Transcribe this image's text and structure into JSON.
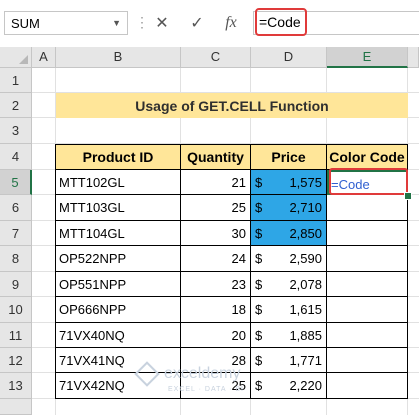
{
  "formula_bar": {
    "name_box": "SUM",
    "cancel_icon": "✕",
    "enter_icon": "✓",
    "fx_label": "fx",
    "formula": "=Code"
  },
  "columns": [
    "A",
    "B",
    "C",
    "D",
    "E"
  ],
  "rows": [
    "1",
    "2",
    "3",
    "4",
    "5",
    "6",
    "7",
    "8",
    "9",
    "10",
    "11",
    "12",
    "13"
  ],
  "title": "Usage of GET.CELL Function",
  "table": {
    "headers": [
      "Product ID",
      "Quantity",
      "Price",
      "Color Code"
    ],
    "rows": [
      {
        "id": "MTT102GL",
        "qty": "21",
        "cur": "$",
        "price": "1,575",
        "code": "=Code"
      },
      {
        "id": "MTT103GL",
        "qty": "25",
        "cur": "$",
        "price": "2,710",
        "code": ""
      },
      {
        "id": "MTT104GL",
        "qty": "30",
        "cur": "$",
        "price": "2,850",
        "code": ""
      },
      {
        "id": "OP522NPP",
        "qty": "24",
        "cur": "$",
        "price": "2,590",
        "code": ""
      },
      {
        "id": "OP551NPP",
        "qty": "23",
        "cur": "$",
        "price": "2,078",
        "code": ""
      },
      {
        "id": "OP666NPP",
        "qty": "18",
        "cur": "$",
        "price": "1,615",
        "code": ""
      },
      {
        "id": "71VX40NQ",
        "qty": "20",
        "cur": "$",
        "price": "1,885",
        "code": ""
      },
      {
        "id": "71VX41NQ",
        "qty": "28",
        "cur": "$",
        "price": "1,771",
        "code": ""
      },
      {
        "id": "71VX42NQ",
        "qty": "25",
        "cur": "$",
        "price": "2,220",
        "code": ""
      }
    ]
  },
  "colors": {
    "highlight_blue": "#2ea6e6",
    "header_yellow": "#ffe699",
    "callout_red": "#e03a3a",
    "excel_green": "#217346"
  },
  "watermark": {
    "name": "exceldemy",
    "tagline": "EXCEL · DATA · BI"
  }
}
